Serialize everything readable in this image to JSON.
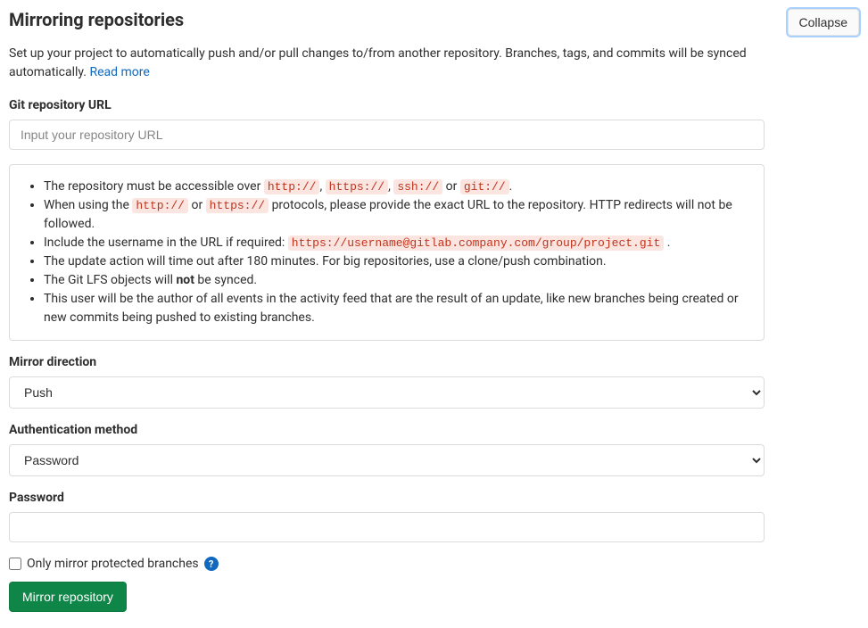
{
  "header": {
    "title": "Mirroring repositories",
    "collapse": "Collapse"
  },
  "description": {
    "text": "Set up your project to automatically push and/or pull changes to/from another repository. Branches, tags, and commits will be synced automatically. ",
    "readMore": "Read more"
  },
  "form": {
    "repoUrl": {
      "label": "Git repository URL",
      "placeholder": "Input your repository URL"
    },
    "helpBox": {
      "item1_prefix": "The repository must be accessible over ",
      "item1_sep": ", ",
      "item1_or": " or ",
      "item1_suffix": ".",
      "code_http": "http://",
      "code_https": "https://",
      "code_ssh": "ssh://",
      "code_git": "git://",
      "item2_prefix": "When using the ",
      "item2_or": " or ",
      "item2_suffix": " protocols, please provide the exact URL to the repository. HTTP redirects will not be followed.",
      "item3_prefix": "Include the username in the URL if required: ",
      "item3_code": "https://username@gitlab.company.com/group/project.git",
      "item3_suffix": " .",
      "item4": "The update action will time out after 180 minutes. For big repositories, use a clone/push combination.",
      "item5_prefix": "The Git LFS objects will ",
      "item5_not": "not",
      "item5_suffix": " be synced.",
      "item6": "This user will be the author of all events in the activity feed that are the result of an update, like new branches being created or new commits being pushed to existing branches."
    },
    "mirrorDirection": {
      "label": "Mirror direction",
      "value": "Push"
    },
    "authMethod": {
      "label": "Authentication method",
      "value": "Password"
    },
    "password": {
      "label": "Password"
    },
    "protectedBranches": {
      "label": "Only mirror protected branches"
    },
    "submit": "Mirror repository"
  }
}
